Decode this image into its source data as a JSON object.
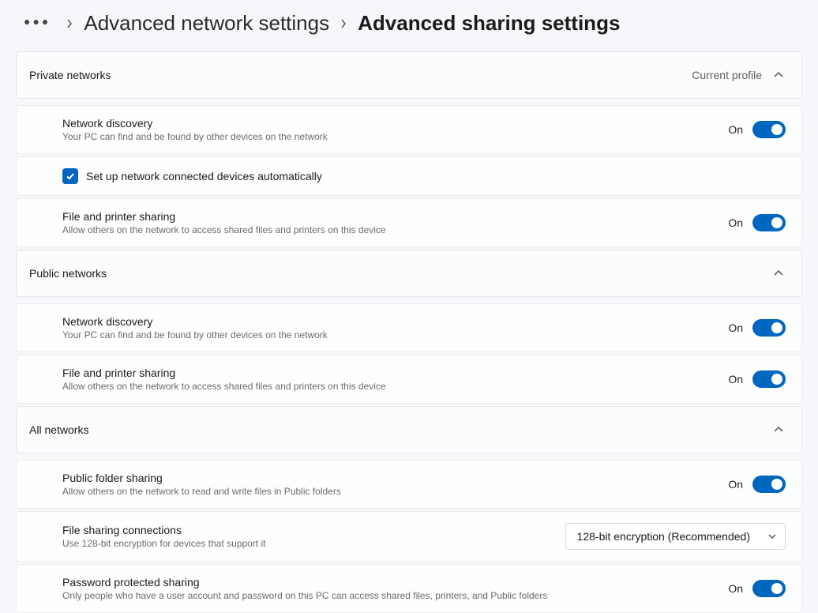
{
  "breadcrumb": {
    "prev": "Advanced network settings",
    "current": "Advanced sharing settings"
  },
  "sections": {
    "private": {
      "title": "Private networks",
      "tag": "Current profile",
      "network_discovery": {
        "label": "Network discovery",
        "desc": "Your PC can find and be found by other devices on the network",
        "state": "On"
      },
      "auto_setup": {
        "label": "Set up network connected devices automatically",
        "checked": true
      },
      "file_printer": {
        "label": "File and printer sharing",
        "desc": "Allow others on the network to access shared files and printers on this device",
        "state": "On"
      }
    },
    "public": {
      "title": "Public networks",
      "network_discovery": {
        "label": "Network discovery",
        "desc": "Your PC can find and be found by other devices on the network",
        "state": "On"
      },
      "file_printer": {
        "label": "File and printer sharing",
        "desc": "Allow others on the network to access shared files and printers on this device",
        "state": "On"
      }
    },
    "all": {
      "title": "All networks",
      "public_folder": {
        "label": "Public folder sharing",
        "desc": "Allow others on the network to read and write files in Public folders",
        "state": "On"
      },
      "file_sharing_conn": {
        "label": "File sharing connections",
        "desc": "Use 128-bit encryption for devices that support it",
        "dropdown": "128-bit encryption (Recommended)"
      },
      "password_protected": {
        "label": "Password protected sharing",
        "desc": "Only people who have a user account and password on this PC can access shared files, printers, and Public folders",
        "state": "On"
      }
    }
  }
}
